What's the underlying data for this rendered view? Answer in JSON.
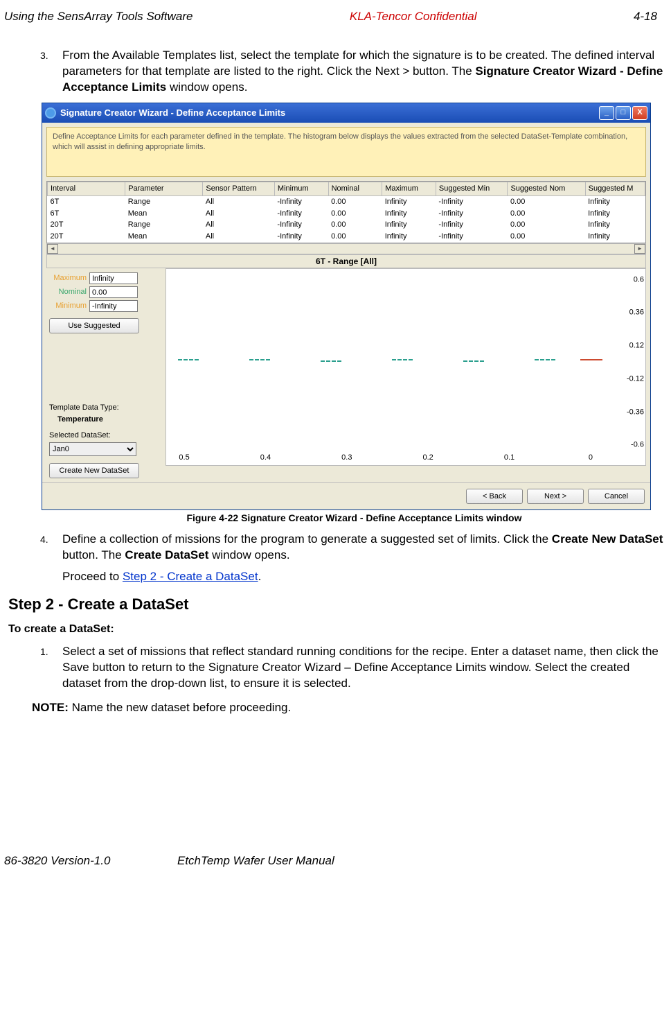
{
  "header": {
    "left": "Using the SensArray Tools Software",
    "mid": "KLA-Tencor Confidential",
    "right": "4-18"
  },
  "step3": {
    "num": "3.",
    "text_a": "From the Available Templates list, select the template for which the signature is to be created. The defined interval parameters for that template are listed to the right. Click the Next > button. The ",
    "text_b_bold": "Signature Creator Wizard - Define Acceptance Limits",
    "text_c": " window opens."
  },
  "win": {
    "title": "Signature Creator Wizard - Define Acceptance Limits",
    "info": "Define Acceptance Limits for each parameter defined in the template.  The histogram below displays the values extracted from the selected DataSet-Template combination, which will assist in defining appropriate limits.",
    "cols": [
      "Interval",
      "Parameter",
      "Sensor Pattern",
      "Minimum",
      "Nominal",
      "Maximum",
      "Suggested Min",
      "Suggested Nom",
      "Suggested M"
    ],
    "rows": [
      [
        "6T",
        "Range",
        "All",
        "-Infinity",
        "0.00",
        "Infinity",
        "-Infinity",
        "0.00",
        "Infinity"
      ],
      [
        "6T",
        "Mean",
        "All",
        "-Infinity",
        "0.00",
        "Infinity",
        "-Infinity",
        "0.00",
        "Infinity"
      ],
      [
        "20T",
        "Range",
        "All",
        "-Infinity",
        "0.00",
        "Infinity",
        "-Infinity",
        "0.00",
        "Infinity"
      ],
      [
        "20T",
        "Mean",
        "All",
        "-Infinity",
        "0.00",
        "Infinity",
        "-Infinity",
        "0.00",
        "Infinity"
      ]
    ],
    "chart_title": "6T - Range [All]",
    "left": {
      "max_label": "Maximum",
      "max_val": "Infinity",
      "nom_label": "Nominal",
      "nom_val": "0.00",
      "min_label": "Minimum",
      "min_val": "-Infinity",
      "use_sugg": "Use Suggested",
      "tdt_label": "Template Data Type:",
      "tdt_val": "Temperature",
      "sds_label": "Selected DataSet:",
      "sds_val": "Jan0",
      "new_ds": "Create New DataSet"
    },
    "btns": {
      "back": "< Back",
      "next": "Next >",
      "cancel": "Cancel"
    }
  },
  "chart_data": {
    "type": "scatter",
    "title": "6T - Range [All]",
    "xlabel": "",
    "ylabel": "",
    "x_ticks": [
      0.5,
      0.4,
      0.3,
      0.2,
      0.1,
      0
    ],
    "y_ticks": [
      0.6,
      0.36,
      0.12,
      -0.12,
      -0.36,
      -0.6
    ],
    "ylim": [
      -0.6,
      0.6
    ],
    "series": [
      {
        "name": "values",
        "style": "dash-teal",
        "x": [
          0.48,
          0.4,
          0.32,
          0.24,
          0.16,
          0.08
        ],
        "y": [
          0.04,
          0.04,
          0.03,
          0.04,
          0.03,
          0.04
        ]
      },
      {
        "name": "marker",
        "style": "solid-red",
        "x": [
          -0.02
        ],
        "y": [
          0.02
        ]
      }
    ]
  },
  "fig_caption": "Figure 4-22 Signature Creator Wizard - Define Acceptance Limits window",
  "step4": {
    "num": "4.",
    "a": "Define a collection of missions for the program to generate a suggested set of limits. Click the ",
    "b_bold": "Create New DataSet",
    "c": " button. The ",
    "d_bold": "Create DataSet",
    "e": " window opens."
  },
  "proceed": {
    "pre": "Proceed to ",
    "link": "Step 2 - Create a DataSet",
    "post": "."
  },
  "h2": "Step 2 - Create a DataSet",
  "sub": "To create a DataSet:",
  "s2_1": {
    "num": "1.",
    "text": "Select a set of missions that reflect standard running conditions for the recipe. Enter a dataset name, then click the Save button to return to the Signature Creator Wizard – Define Acceptance Limits window. Select the created dataset from the drop-down list, to ensure it is selected."
  },
  "note": {
    "label": "NOTE:",
    "text": " Name the new dataset before proceeding."
  },
  "footer": {
    "left": "86-3820 Version-1.0",
    "mid": "EtchTemp Wafer User Manual"
  }
}
